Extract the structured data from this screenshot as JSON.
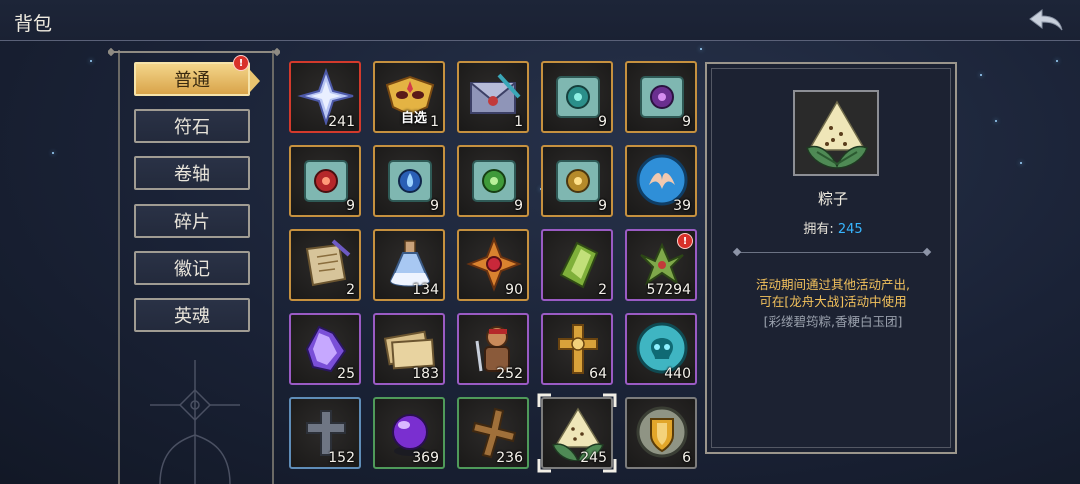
{
  "header": {
    "title": "背包",
    "back_icon": "back-arrow-icon"
  },
  "sidebar": {
    "tabs": [
      {
        "label": "普通",
        "active": true,
        "badge": "!"
      },
      {
        "label": "符石",
        "active": false
      },
      {
        "label": "卷轴",
        "active": false
      },
      {
        "label": "碎片",
        "active": false
      },
      {
        "label": "徽记",
        "active": false
      },
      {
        "label": "英魂",
        "active": false
      }
    ]
  },
  "inventory": {
    "items": [
      {
        "icon": "star-crystal-icon",
        "count": "241",
        "border": "#d33a2c"
      },
      {
        "icon": "golden-mask-icon",
        "count": "1",
        "tag": "自选",
        "border": "#c6913f"
      },
      {
        "icon": "letter-envelope-icon",
        "count": "1",
        "border": "#c6913f"
      },
      {
        "icon": "cyan-rune-scroll-icon",
        "count": "9",
        "border": "#c6913f"
      },
      {
        "icon": "purple-rune-scroll-icon",
        "count": "9",
        "border": "#c6913f"
      },
      {
        "icon": "red-rune-scroll-icon",
        "count": "9",
        "border": "#c6913f"
      },
      {
        "icon": "blue-rune-scroll-icon",
        "count": "9",
        "border": "#c6913f"
      },
      {
        "icon": "green-rune-scroll-icon",
        "count": "9",
        "border": "#c6913f"
      },
      {
        "icon": "gold-rune-scroll-icon",
        "count": "9",
        "border": "#c6913f"
      },
      {
        "icon": "wing-emblem-icon",
        "count": "39",
        "border": "#c6913f"
      },
      {
        "icon": "parchment-scroll-icon",
        "count": "2",
        "border": "#c6913f"
      },
      {
        "icon": "potion-bottle-icon",
        "count": "134",
        "border": "#c6913f"
      },
      {
        "icon": "orange-shuriken-icon",
        "count": "90",
        "border": "#c6913f"
      },
      {
        "icon": "green-crystal-icon",
        "count": "2",
        "border": "#9a5bc4"
      },
      {
        "icon": "green-shuriken-icon",
        "count": "57294",
        "badge": "!",
        "border": "#9a5bc4"
      },
      {
        "icon": "purple-crystal-icon",
        "count": "25",
        "border": "#9a5bc4"
      },
      {
        "icon": "ticket-icon",
        "count": "183",
        "border": "#9a5bc4"
      },
      {
        "icon": "warrior-icon",
        "count": "252",
        "border": "#9a5bc4"
      },
      {
        "icon": "golden-cross-icon",
        "count": "64",
        "border": "#9a5bc4"
      },
      {
        "icon": "skull-coin-icon",
        "count": "440",
        "border": "#9a5bc4"
      },
      {
        "icon": "stone-cross-icon",
        "count": "152",
        "border": "#5f8db8"
      },
      {
        "icon": "purple-orb-icon",
        "count": "369",
        "border": "#4f9a5a"
      },
      {
        "icon": "wooden-cross-icon",
        "count": "236",
        "border": "#4f9a5a"
      },
      {
        "icon": "zongzi-icon",
        "count": "245",
        "border": "#7c7c7c",
        "selected": true
      },
      {
        "icon": "shield-emblem-icon",
        "count": "6",
        "border": "#7c7c7c"
      }
    ]
  },
  "detail": {
    "icon": "zongzi-icon",
    "name": "粽子",
    "own_label": "拥有:",
    "own_count": "245",
    "desc_line1": "活动期间通过其他活动产出,",
    "desc_line2": "可在[龙舟大战]活动中使用",
    "note": "[彩缕碧筠粽,香粳白玉团]"
  },
  "colors": {
    "accent": "#e9c46f",
    "count_blue": "#38b6ff",
    "desc": "#f2c15c"
  }
}
